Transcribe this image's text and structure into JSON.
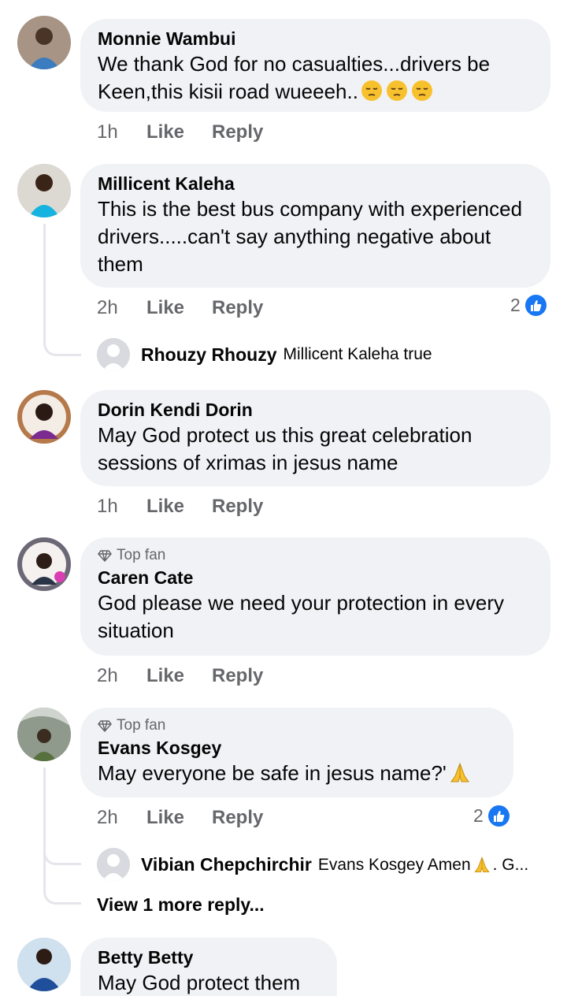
{
  "comments": [
    {
      "author": "Monnie Wambui",
      "text": "We thank God for no casualties...drivers be Keen,this kisii road wueeeh..",
      "emoji_count": 3,
      "time": "1h",
      "like": "Like",
      "reply": "Reply"
    },
    {
      "author": "Millicent Kaleha",
      "text": "This is the best bus company with experienced drivers.....can't say anything negative about them",
      "time": "2h",
      "like": "Like",
      "reply": "Reply",
      "reactions": "2",
      "reply_item": {
        "author": "Rhouzy Rhouzy",
        "text": "Millicent Kaleha true"
      }
    },
    {
      "author": "Dorin Kendi Dorin",
      "text": "May God protect us this great celebration sessions of xrimas in jesus name",
      "time": "1h",
      "like": "Like",
      "reply": "Reply"
    },
    {
      "badge": "Top fan",
      "author": "Caren Cate",
      "text": "God please we need your protection in every situation",
      "time": "2h",
      "like": "Like",
      "reply": "Reply"
    },
    {
      "badge": "Top fan",
      "author": "Evans Kosgey",
      "text": "May everyone be safe in jesus name?'",
      "time": "2h",
      "like": "Like",
      "reply": "Reply",
      "reactions": "2",
      "reply_item": {
        "author": "Vibian Chepchirchir",
        "text": "Evans Kosgey Amen",
        "text_tail": ". G..."
      },
      "view_more": "View 1 more reply..."
    },
    {
      "author": "Betty Betty",
      "text": "May God protect them"
    }
  ],
  "colors": {
    "bubble": "#f0f2f5",
    "secondary_text": "#65676b",
    "like_blue": "#1877f2"
  },
  "icons": {
    "top_fan": "diamond-icon",
    "reaction": "thumbs-up-icon",
    "emoji_sad": "pensive-face-icon",
    "emoji_pray": "praying-hands-icon"
  }
}
